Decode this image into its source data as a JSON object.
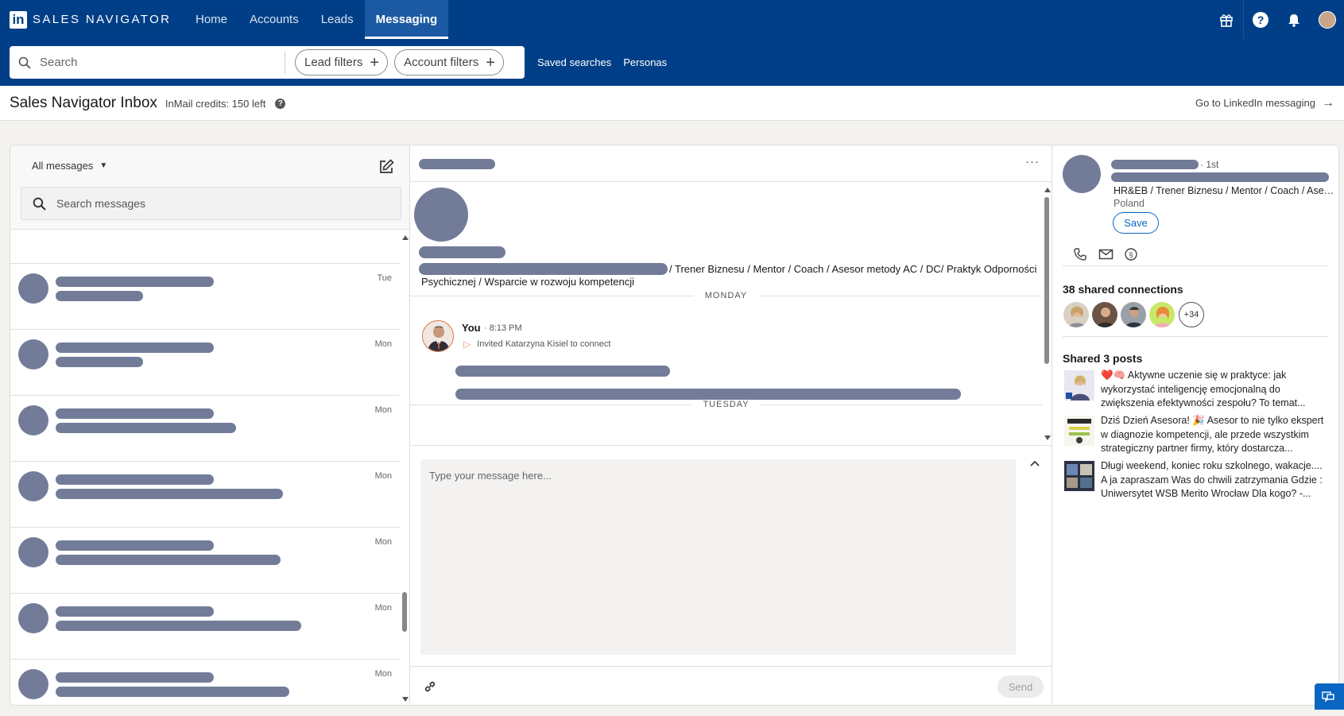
{
  "nav": {
    "logo": "in",
    "brand": "SALES NAVIGATOR",
    "tabs": [
      {
        "label": "Home"
      },
      {
        "label": "Accounts"
      },
      {
        "label": "Leads"
      },
      {
        "label": "Messaging"
      }
    ],
    "active_tab": "Messaging",
    "icons": [
      "gift-icon",
      "help-icon",
      "bell-icon",
      "avatar"
    ]
  },
  "search": {
    "placeholder": "Search",
    "lead_filters": "Lead filters",
    "account_filters": "Account filters",
    "saved_searches": "Saved searches",
    "personas": "Personas"
  },
  "subheader": {
    "title": "Sales Navigator Inbox",
    "credits": "InMail credits: 150 left",
    "goto": "Go to LinkedIn messaging"
  },
  "left": {
    "filter_label": "All messages",
    "search_placeholder": "Search messages",
    "conversations": [
      {
        "day": "Tue",
        "line2_width": 110
      },
      {
        "day": "Mon",
        "line2_width": 110
      },
      {
        "day": "Mon",
        "line2_width": 227
      },
      {
        "day": "Mon",
        "line2_width": 286
      },
      {
        "day": "Mon",
        "line2_width": 283
      },
      {
        "day": "Mon",
        "line2_width": 309
      },
      {
        "day": "Mon",
        "line2_width": 294
      }
    ]
  },
  "thread": {
    "headline": "/ Trener Biznesu / Mentor / Coach / Asesor metody AC / DC/ Praktyk Odporności Psychicznej / Wsparcie w rozwoju kompetencji",
    "day1": "MONDAY",
    "day2": "TUESDAY",
    "sender": "You",
    "time": "· 8:13 PM",
    "invite_text": "Invited Katarzyna Kisiel to connect",
    "composer_placeholder": "Type your message here...",
    "send_label": "Send"
  },
  "profile": {
    "degree": "· 1st",
    "headline": "HR&EB / Trener Biznesu / Mentor / Coach / Asesor metody AC / DC",
    "location": "Poland",
    "save_label": "Save",
    "shared_connections": "38 shared connections",
    "more_count": "+34",
    "shared_posts_title": "Shared 3 posts",
    "posts": [
      {
        "text": "❤️🧠 Aktywne uczenie się w praktyce: jak wykorzystać inteligencję emocjonalną do zwiększenia efektywności zespołu? To temat..."
      },
      {
        "text": "Dziś Dzień Asesora! 🎉 Asesor to nie tylko ekspert w diagnozie kompetencji, ale przede wszystkim strategiczny partner firmy, który dostarcza..."
      },
      {
        "text": "Długi weekend, koniec roku szkolnego, wakacje.... A ja zapraszam Was do chwili zatrzymania Gdzie : Uniwersytet WSB Merito Wrocław Dla kogo? -..."
      }
    ]
  },
  "colors": {
    "nav_bg": "#003f87",
    "placeholder_gray": "#727c99",
    "accent_blue": "#0a66c2"
  }
}
